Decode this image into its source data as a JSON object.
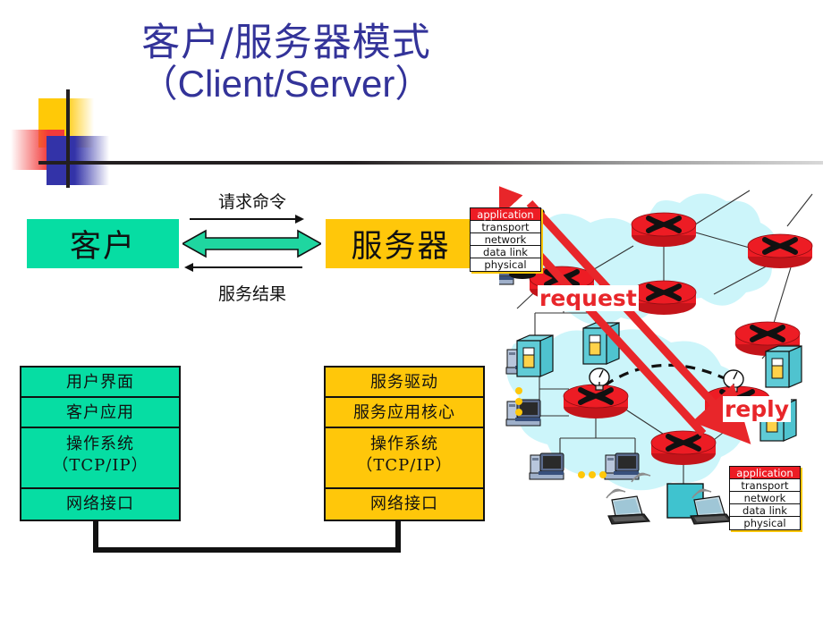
{
  "slide": {
    "title_line1": "客户/服务器模式",
    "title_line2_open": "（",
    "title_line2_text": "Client/Server",
    "title_line2_close": "）",
    "title_color": "#333399"
  },
  "diagram": {
    "client_label": "客户",
    "server_label": "服务器",
    "client_color": "#06DDA3",
    "server_color": "#FFC70A",
    "request_label": "请求命令",
    "response_label": "服务结果"
  },
  "client_stack": {
    "rows": [
      {
        "label": "用户界面"
      },
      {
        "label": "客户应用"
      },
      {
        "label": "操作系统",
        "label2": "（TCP/IP）"
      },
      {
        "label": "网络接口"
      }
    ]
  },
  "server_stack": {
    "rows": [
      {
        "label": "服务驱动"
      },
      {
        "label": "服务应用核心"
      },
      {
        "label": "操作系统",
        "label2": "（TCP/IP）"
      },
      {
        "label": "网络接口"
      }
    ]
  },
  "protocol_stack": {
    "layers": [
      "application",
      "transport",
      "network",
      "data link",
      "physical"
    ],
    "highlight_color": "#ED1C24"
  },
  "network": {
    "request_tag": "request",
    "reply_tag": "reply",
    "arrow_color": "#E8262A",
    "cloud_color": "#CCF5FA",
    "router_color": "#ED1C24"
  }
}
